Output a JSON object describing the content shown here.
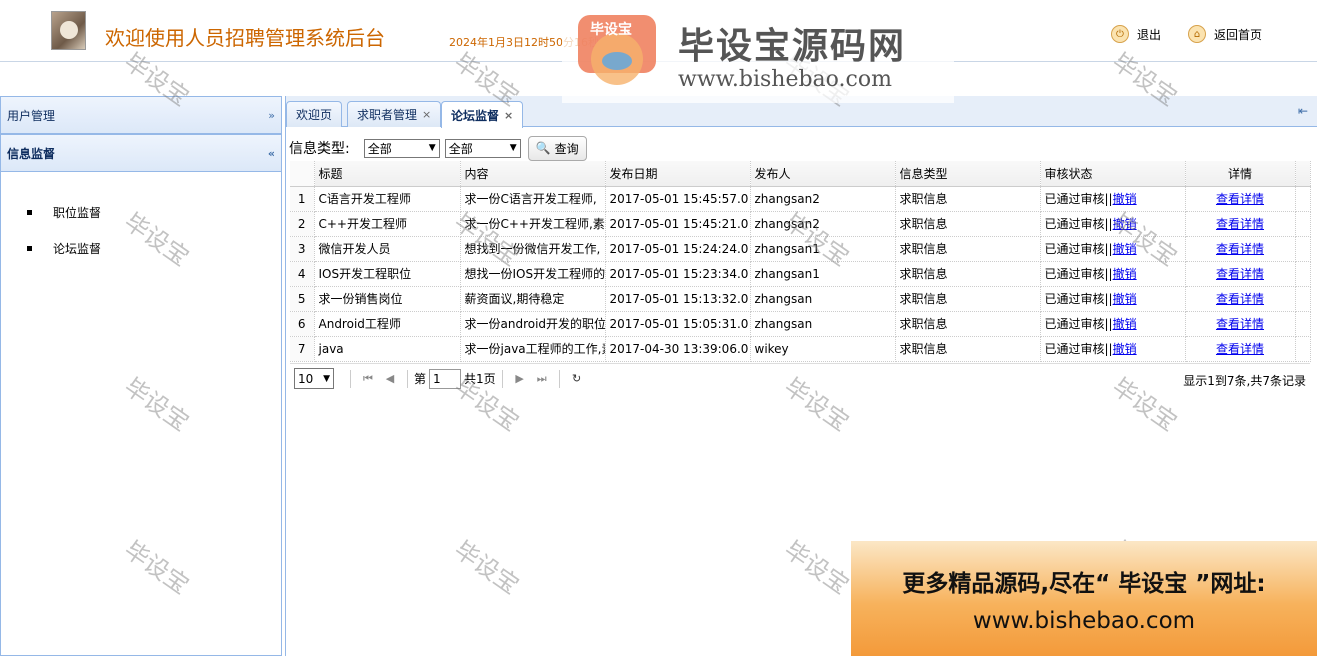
{
  "header": {
    "title": "欢迎使用人员招聘管理系统后台",
    "datetime": "2024年1月3日12时50分16秒",
    "logout_label": "退出",
    "home_label": "返回首页"
  },
  "sidebar": {
    "sections": [
      {
        "label": "用户管理",
        "chevron": "»"
      },
      {
        "label": "信息监督",
        "chevron": "«"
      }
    ],
    "items": [
      {
        "label": "职位监督"
      },
      {
        "label": "论坛监督"
      }
    ]
  },
  "tabs": [
    {
      "label": "欢迎页",
      "closable": false
    },
    {
      "label": "求职者管理",
      "closable": true
    },
    {
      "label": "论坛监督",
      "closable": true
    }
  ],
  "close_glyph": "×",
  "toolbar": {
    "label": "信息类型:",
    "select1": "全部",
    "select2": "全部",
    "query_label": "查询"
  },
  "grid": {
    "columns": [
      "标题",
      "内容",
      "发布日期",
      "发布人",
      "信息类型",
      "审核状态",
      "详情"
    ],
    "rows": [
      {
        "n": "1",
        "title": "C语言开发工程师",
        "content": "求一份C语言开发工程师,",
        "date": "2017-05-01 15:45:57.0",
        "user": "zhangsan2",
        "type": "求职信息",
        "status": "已通过审核||",
        "action": "撤销",
        "detail": "查看详情"
      },
      {
        "n": "2",
        "title": "C++开发工程师",
        "content": "求一份C++开发工程师,素",
        "date": "2017-05-01 15:45:21.0",
        "user": "zhangsan2",
        "type": "求职信息",
        "status": "已通过审核||",
        "action": "撤销",
        "detail": "查看详情"
      },
      {
        "n": "3",
        "title": "微信开发人员",
        "content": "想找到一份微信开发工作,",
        "date": "2017-05-01 15:24:24.0",
        "user": "zhangsan1",
        "type": "求职信息",
        "status": "已通过审核||",
        "action": "撤销",
        "detail": "查看详情"
      },
      {
        "n": "4",
        "title": "IOS开发工程职位",
        "content": "想找一份IOS开发工程师的",
        "date": "2017-05-01 15:23:34.0",
        "user": "zhangsan1",
        "type": "求职信息",
        "status": "已通过审核||",
        "action": "撤销",
        "detail": "查看详情"
      },
      {
        "n": "5",
        "title": "求一份销售岗位",
        "content": "薪资面议,期待稳定",
        "date": "2017-05-01 15:13:32.0",
        "user": "zhangsan",
        "type": "求职信息",
        "status": "已通过审核||",
        "action": "撤销",
        "detail": "查看详情"
      },
      {
        "n": "6",
        "title": "Android工程师",
        "content": "求一份android开发的职位",
        "date": "2017-05-01 15:05:31.0",
        "user": "zhangsan",
        "type": "求职信息",
        "status": "已通过审核||",
        "action": "撤销",
        "detail": "查看详情"
      },
      {
        "n": "7",
        "title": "java",
        "content": "求一份java工程师的工作,素",
        "date": "2017-04-30 13:39:06.0",
        "user": "wikey",
        "type": "求职信息",
        "status": "已通过审核||",
        "action": "撤销",
        "detail": "查看详情"
      }
    ]
  },
  "pager": {
    "page_size": "10",
    "page_prefix": "第",
    "page_value": "1",
    "page_total": "共1页",
    "info": "显示1到7条,共7条记录"
  },
  "watermark": {
    "text": "毕设宝",
    "brand_name": "毕设宝源码网",
    "brand_url": "www.bishebao.com",
    "badge_text": "毕设宝"
  },
  "promo": {
    "line1": "更多精品源码,尽在“ 毕设宝 ”网址:",
    "line2": "www.bishebao.com"
  },
  "colors": {
    "title": "#cc6600",
    "panel_border": "#95b8e7",
    "link": "#0000ee"
  }
}
